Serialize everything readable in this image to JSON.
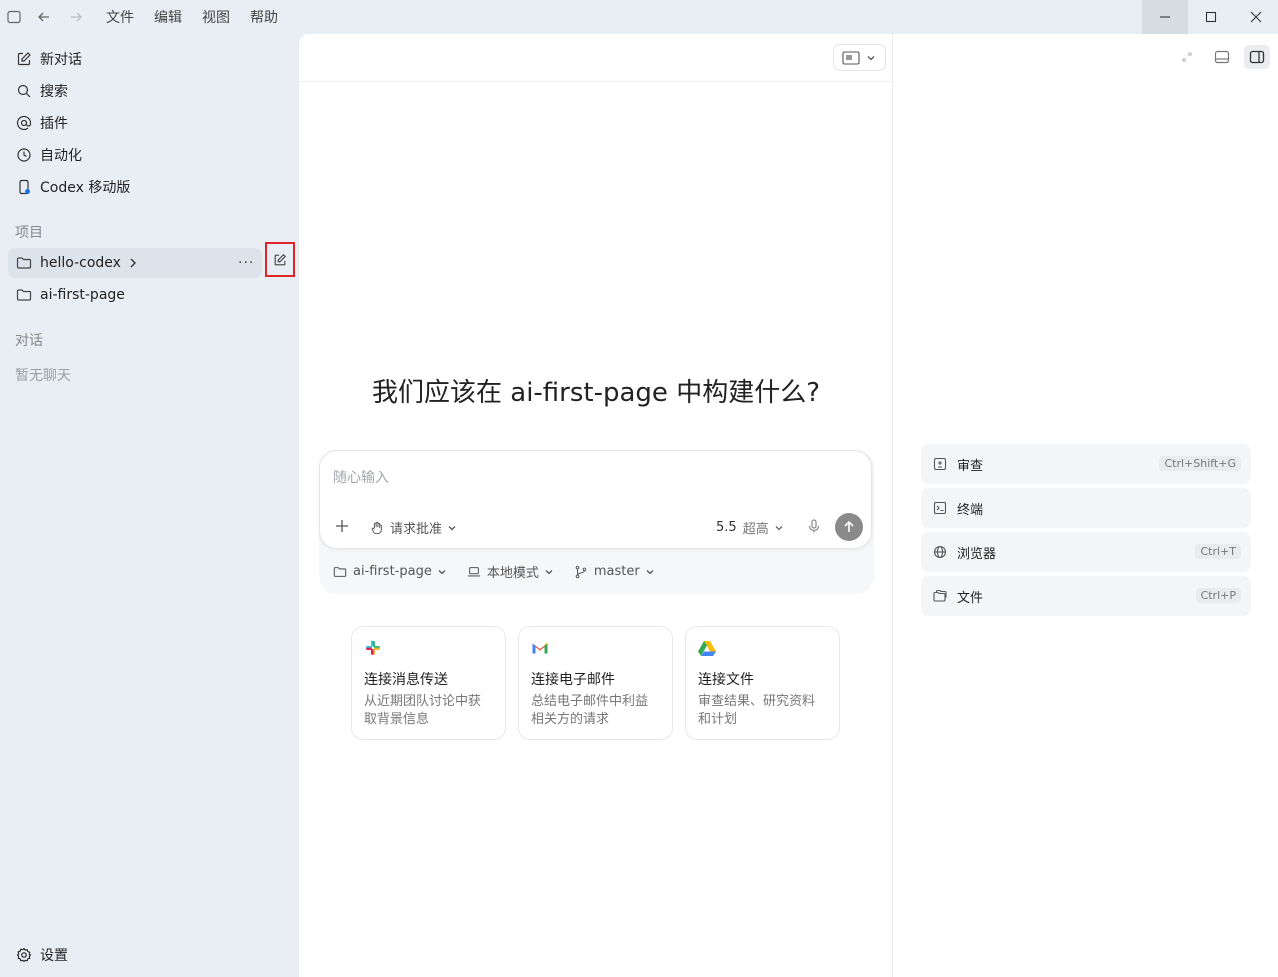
{
  "menu": {
    "file": "文件",
    "edit": "编辑",
    "view": "视图",
    "help": "帮助"
  },
  "sidebar": {
    "items": [
      {
        "label": "新对话",
        "icon": "edit-icon"
      },
      {
        "label": "搜索",
        "icon": "search-icon"
      },
      {
        "label": "插件",
        "icon": "at-icon"
      },
      {
        "label": "自动化",
        "icon": "clock-icon"
      },
      {
        "label": "Codex 移动版",
        "icon": "mobile-icon"
      }
    ],
    "projects_label": "项目",
    "projects": [
      {
        "label": "hello-codex"
      },
      {
        "label": "ai-first-page"
      }
    ],
    "chats_label": "对话",
    "chats_empty": "暂无聊天",
    "settings_label": "设置",
    "more_label": "···"
  },
  "main": {
    "headline": "我们应该在 ai-first-page 中构建什么?",
    "composer": {
      "placeholder": "随心输入",
      "approval": "请求批准",
      "model_version": "5.5",
      "model_level": "超高"
    },
    "context": {
      "project": "ai-first-page",
      "mode": "本地模式",
      "branch": "master"
    },
    "cards": [
      {
        "title": "连接消息传送",
        "desc1": "从近期团队讨论中获",
        "desc2": "取背景信息",
        "logo": "slack-logo"
      },
      {
        "title": "连接电子邮件",
        "desc1": "总结电子邮件中利益",
        "desc2": "相关方的请求",
        "logo": "gmail-logo"
      },
      {
        "title": "连接文件",
        "desc1": "审查结果、研究资料",
        "desc2": "和计划",
        "logo": "drive-logo"
      }
    ]
  },
  "right_panel": {
    "rows": [
      {
        "label": "审查",
        "shortcut": "Ctrl+Shift+G",
        "icon": "review-icon"
      },
      {
        "label": "终端",
        "shortcut": "",
        "icon": "terminal-icon"
      },
      {
        "label": "浏览器",
        "shortcut": "Ctrl+T",
        "icon": "globe-icon"
      },
      {
        "label": "文件",
        "shortcut": "Ctrl+P",
        "icon": "files-icon"
      }
    ]
  },
  "colors": {
    "sidebar_bg": "#e9eef5",
    "highlight_border": "#e0252a",
    "send_button": "#8a8a8a"
  }
}
